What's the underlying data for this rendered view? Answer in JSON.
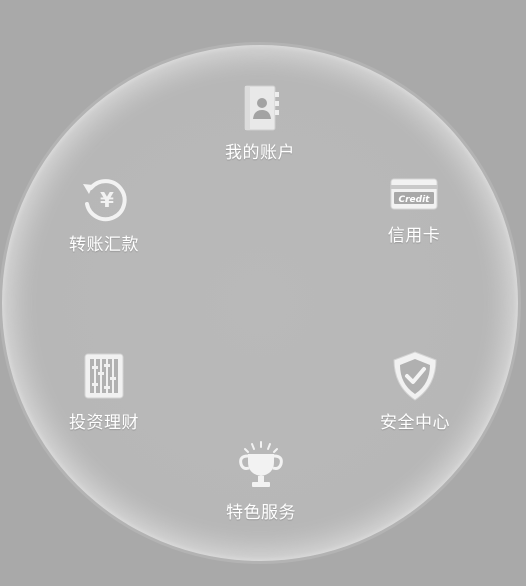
{
  "menu": {
    "items": [
      {
        "label": "我的账户",
        "icon": "contact-book-icon"
      },
      {
        "label": "信用卡",
        "icon": "credit-card-icon",
        "card_text": "Credit"
      },
      {
        "label": "安全中心",
        "icon": "shield-check-icon"
      },
      {
        "label": "特色服务",
        "icon": "trophy-icon"
      },
      {
        "label": "投资理财",
        "icon": "abacus-icon"
      },
      {
        "label": "转账汇款",
        "icon": "yen-refresh-icon",
        "glyph": "¥"
      }
    ]
  },
  "colors": {
    "background": "#a9a9a9",
    "dial": "#b8b8b8",
    "icon_light": "#f4f4f4",
    "label": "#ffffff"
  }
}
